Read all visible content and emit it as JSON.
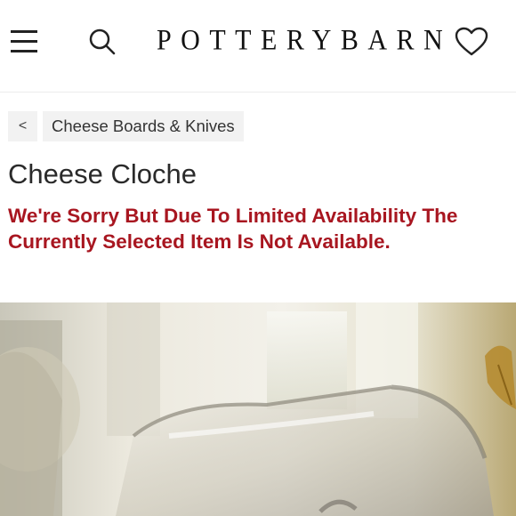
{
  "header": {
    "logo_text": "POTTERYBARN",
    "icons": {
      "menu": "hamburger-menu-icon",
      "search": "search-icon",
      "wishlist": "heart-icon"
    }
  },
  "breadcrumb": {
    "back_label": "<",
    "category_label": "Cheese Boards & Knives"
  },
  "product": {
    "title": "Cheese Cloche",
    "availability_notice_line1": "We're Sorry But Due To Limited Availability The",
    "availability_notice_line2": "Currently Selected Item Is Not Available.",
    "image_description_icon": "product-photo"
  },
  "colors": {
    "notice_red": "#a81620",
    "breadcrumb_bg": "#f2f2f2",
    "text_dark": "#222222"
  }
}
